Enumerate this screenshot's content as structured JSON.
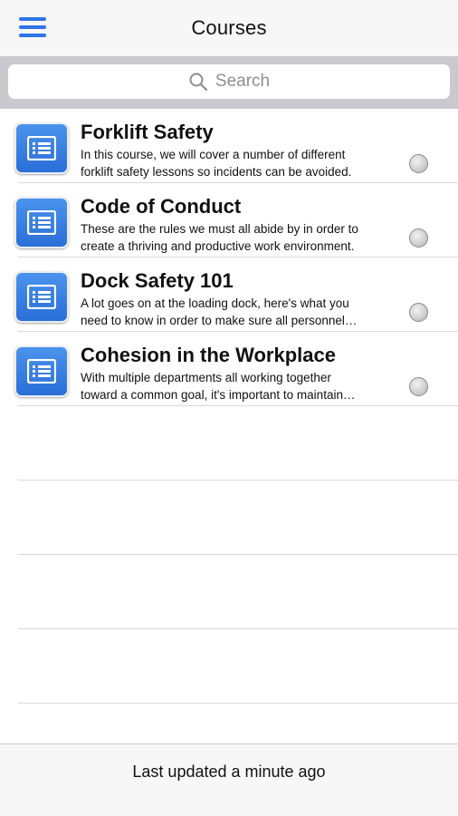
{
  "header": {
    "title": "Courses",
    "menu_icon": "hamburger-menu-icon",
    "accent_color": "#2f74e8"
  },
  "search": {
    "placeholder": "Search",
    "icon": "search-icon"
  },
  "courses": [
    {
      "title": "Forklift Safety",
      "desc_line1": "In this course, we will cover a number of different",
      "desc_line2": "forklift safety lessons so incidents can be avoided.",
      "icon": "list-document-icon"
    },
    {
      "title": "Code of Conduct",
      "desc_line1": "These are the rules we must all abide by in order to",
      "desc_line2": "create a thriving and productive work environment.",
      "icon": "list-document-icon"
    },
    {
      "title": "Dock Safety 101",
      "desc_line1": "A lot goes on at the loading dock, here's what you",
      "desc_line2": "need to know in order to make sure all personnel…",
      "icon": "list-document-icon"
    },
    {
      "title": "Cohesion in the Workplace",
      "desc_line1": "With multiple departments all working together",
      "desc_line2": "toward a common goal, it's important to maintain…",
      "icon": "list-document-icon"
    }
  ],
  "footer": {
    "status": "Last updated a minute ago"
  }
}
